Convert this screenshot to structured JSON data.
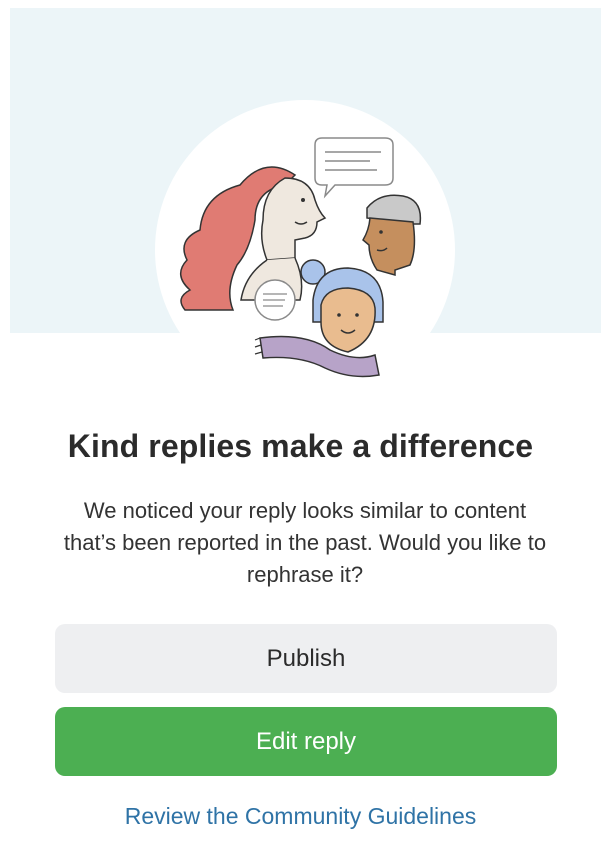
{
  "dialog": {
    "title": "Kind replies make a difference",
    "message": "We noticed your reply looks similar to content that’s been reported in the past. Would you like to rephrase it?",
    "publish_label": "Publish",
    "edit_label": "Edit reply",
    "guidelines_link": "Review the Community Guidelines"
  },
  "illustration": {
    "icons": [
      "woman-with-red-hair",
      "man-with-gray-hair",
      "woman-with-blue-bun",
      "speech-bubble-icon",
      "scarf"
    ]
  },
  "colors": {
    "hero_background": "#ecf5f8",
    "primary_button": "#4caf52",
    "secondary_button": "#eeeff1",
    "link": "#2f73a6",
    "hair_red": "#e07b73",
    "hair_blue": "#a9c3ea",
    "scarf_purple": "#b7a3c8"
  }
}
